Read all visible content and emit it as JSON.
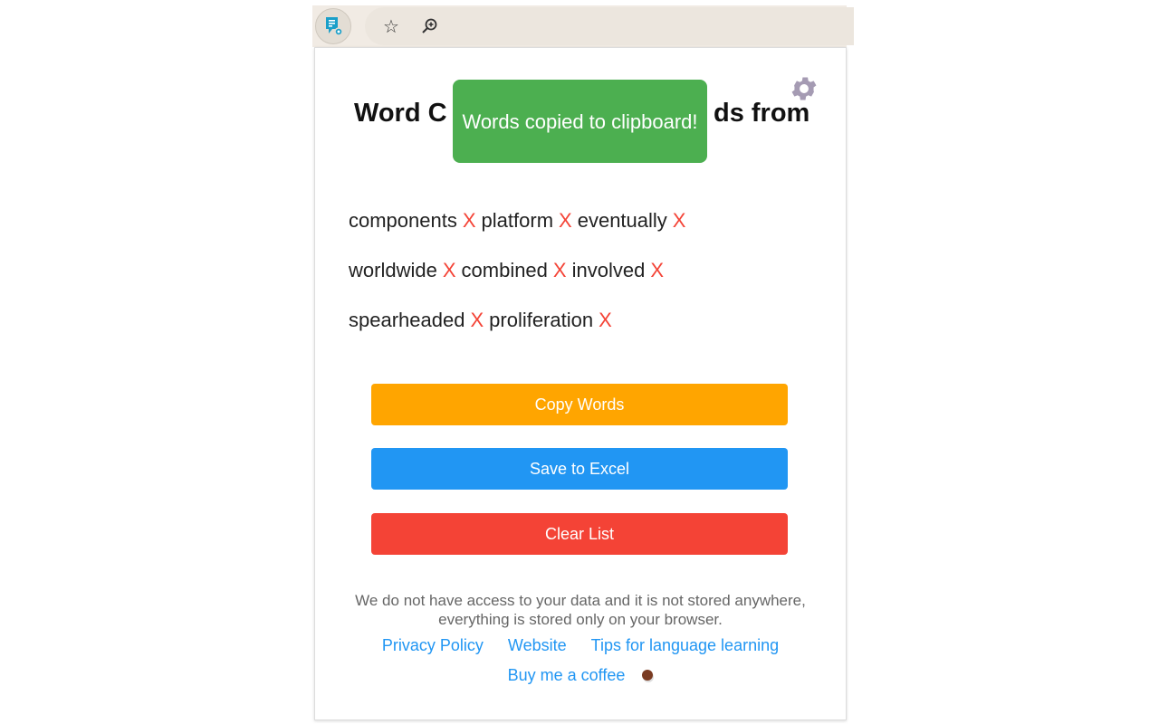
{
  "toolbar": {
    "extension_icon": "notes-gear-icon",
    "bookmark_icon": "star-icon",
    "zoom_icon": "zoom-in-icon"
  },
  "popup": {
    "title_left": "Word C",
    "title_right": "ds from",
    "toast": "Words copied to clipboard!",
    "remove_label": "X",
    "word_rows": [
      [
        "components",
        "platform",
        "eventually"
      ],
      [
        "worldwide",
        "combined",
        "involved"
      ],
      [
        "spearheaded",
        "proliferation"
      ]
    ],
    "buttons": {
      "copy": "Copy Words",
      "save": "Save to Excel",
      "clear": "Clear List"
    },
    "colors": {
      "copy": "#ffa500",
      "save": "#2196f3",
      "clear": "#f44336",
      "toast": "#4caf50"
    },
    "note": "We do not have access to your data and it is not stored anywhere, everything is stored only on your browser.",
    "links": {
      "privacy": "Privacy Policy",
      "website": "Website",
      "tips": "Tips for language learning",
      "coffee": "Buy me a coffee"
    }
  }
}
